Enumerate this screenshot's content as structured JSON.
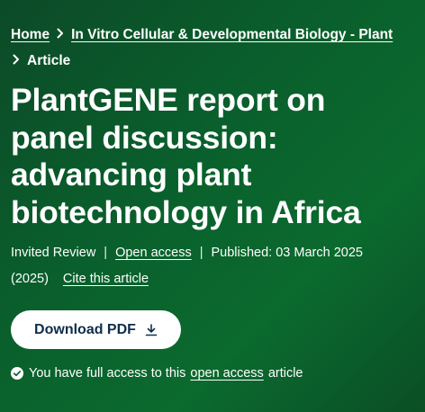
{
  "breadcrumb": {
    "home": "Home",
    "journal": "In Vitro Cellular & Developmental Biology - Plant",
    "current": "Article"
  },
  "article": {
    "title": "PlantGENE report on panel discussion: advancing plant biotechnology in Africa",
    "type": "Invited Review",
    "access_label": "Open access",
    "published": "Published: 03 March 2025",
    "year": "(2025)",
    "cite_label": "Cite this article"
  },
  "actions": {
    "download_label": "Download PDF"
  },
  "access_notice": {
    "prefix": "You have full access to this",
    "link": "open access",
    "suffix": "article"
  },
  "colors": {
    "background": "#0a5f2c",
    "button_bg": "#ffffff",
    "button_text": "#0f2d4b"
  },
  "icons": {
    "breadcrumb_separator": "chevron-right-icon",
    "download": "download-icon",
    "access": "check-circle-icon"
  }
}
